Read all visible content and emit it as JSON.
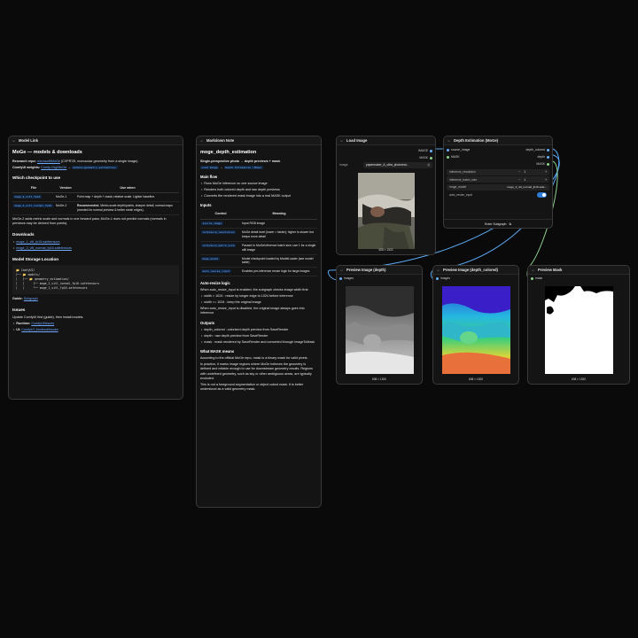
{
  "model_link": {
    "header": "Model Link",
    "title": "MoGe — models & downloads",
    "research_label": "Research repo:",
    "research_link": "microsoft/MoGe",
    "research_desc": "(CVPR'25, monocular geometry from a single image).",
    "weights_label": "ComfyUI weights:",
    "weights_link": "Comfy-Org/MoGe",
    "weights_arrow": "→",
    "weights_code": "models/geometry_estimation/",
    "checkpoint_title": "Which checkpoint to use",
    "table_headers": [
      "File",
      "Version",
      "Use when"
    ],
    "rows": [
      {
        "file": "moge_2_vitl_fp16",
        "version": "MoGe-1",
        "use": "Point map + depth + mask; relative scale. Lighter baseline."
      },
      {
        "file": "moge_2_vitl_normal_fp16",
        "version": "MoGe-2",
        "use_bold": "Recommended.",
        "use": "Metric-scale depth/points, sharper detail, normal maps (needed for normal preview & better mesh edges)."
      }
    ],
    "note": "MoGe-2 adds metric scale and normals in one forward pass; MoGe-1 does not predict normals (normals in previews may be derived from points).",
    "downloads_title": "Downloads",
    "downloads": [
      "moge_1_vitl_fp16.safetensors",
      "moge_2_vitl_normal_fp16.safetensors"
    ],
    "storage_title": "Model Storage Location",
    "tree": "📂 ComfyUI/\n├── 📂 models/\n│   ├── 📂 geometry_estimation/\n│   │     ├── moge_2_vitl_normal_fp16.safetensors\n│   │     └── moge_1_vitl_fp16.safetensors",
    "guide_label": "Guide:",
    "guide_link": "Subgraph",
    "issues_title": "Issues",
    "issues_text": "Update ComfyUI first (guide), then install models.",
    "issues_items": [
      {
        "label": "Runtime:",
        "link": "ComfyUI/issues"
      },
      {
        "label": "UI:",
        "link": "ComfyUI_frontend/issues"
      }
    ]
  },
  "markdown_note": {
    "header": "Markdown Note",
    "title": "moge_depth_estimation",
    "subtitle": "Single-perspective photo → depth previews + mask",
    "chips": [
      "Load Image",
      "Depth Estimation (MoGe)"
    ],
    "main_flow_title": "Main flow",
    "main_flow": [
      "Runs MoGe inference on one source image",
      "Renders both colored depth and raw depth previews",
      "Converts the rendered mask image into a real MASK output"
    ],
    "inputs_title": "Inputs",
    "inputs_headers": [
      "Control",
      "Meaning"
    ],
    "inputs_rows": [
      {
        "control": "source_image",
        "meaning": "Input RGB image"
      },
      {
        "control": "inference_resolution",
        "meaning": "MoGe detail level (lower = faster); higher is slower but keeps more detail"
      },
      {
        "control": "inference_batch_size",
        "meaning": "Passed to MoGeInference batch size; use 1 for a single still image"
      },
      {
        "control": "moge_model",
        "meaning": "Model checkpoint loaded by ModelLoader (see model table)"
      },
      {
        "control": "auto_resize_input",
        "meaning": "Enables pre-inference resize logic for large images"
      }
    ],
    "autoresize_title": "Auto-resize logic",
    "autoresize_when": "When auto_resize_input is enabled, the subgraph checks image width first:",
    "autoresize_items": [
      "width > 1024 : resize by longer edge to 1024 before inference",
      "width <= 1024 : keep the original image"
    ],
    "autoresize_disabled": "When auto_resize_input is disabled, the original image always goes into inference.",
    "outputs_title": "Outputs",
    "outputs": [
      "depth_colored : colorized depth preview from SaveRender",
      "depth : raw depth preview from SaveRender",
      "mask : mask rendered by SaveRender and converted through ImageToMask"
    ],
    "what_title": "What MASK means",
    "what_p1": "According to the official MoGe repo, mask is a binary mask for valid pixels.",
    "what_p2": "In practice, it marks image regions where MoGe believes the geometry is defined and reliable enough to use for downstream geometry results. Regions with undefined geometry, such as sky or other ambiguous areas, are typically excluded.",
    "what_p3": "This is not a foreground segmentation or object cutout mask. It is better understood as a valid geometry mask."
  },
  "load_image": {
    "header": "Load Image",
    "outputs": [
      "IMAGE",
      "MASK"
    ],
    "widget_label": "image",
    "widget_value": "papermaker_A_ultra_photoreal...",
    "caption": "608 × 1520"
  },
  "depth_node": {
    "header": "Depth Estimation (MoGe)",
    "inputs": [
      "source_image",
      "MASK"
    ],
    "outputs": [
      "depth_colored",
      "depth",
      "MASK"
    ],
    "widgets": [
      {
        "label": "inference_resolution",
        "value": "1"
      },
      {
        "label": "inference_batch_size",
        "value": "1"
      },
      {
        "label": "moge_model",
        "value": "moge_2_vitl_normal_fp16.safe..."
      },
      {
        "label": "auto_resize_input",
        "value": "true"
      }
    ],
    "footer": "Enter Subgraph"
  },
  "preview_depth": {
    "header": "Preview Image (depth)",
    "input": "images",
    "caption": "608 × 1520"
  },
  "preview_colored": {
    "header": "Preview Image (depth_colored)",
    "input": "images",
    "caption": "608 × 1520"
  },
  "preview_mask": {
    "header": "Preview Mask",
    "input": "mask",
    "caption": "608 × 1520"
  },
  "colors": {
    "link_blue": "#5aa8f0",
    "link_green": "#8fd38f",
    "toggle": "#2f7dd6"
  }
}
